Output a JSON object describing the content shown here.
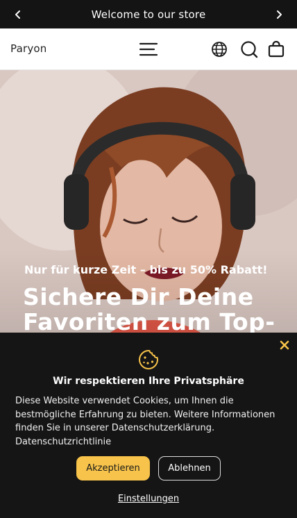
{
  "announcement": {
    "text": "Welcome to our store",
    "prev_icon": "chevron-left-icon",
    "next_icon": "chevron-right-icon"
  },
  "header": {
    "logo": "Paryon",
    "menu_icon": "hamburger-menu-icon",
    "icons": [
      "globe-icon",
      "search-icon",
      "shopping-bag-icon"
    ]
  },
  "hero": {
    "kicker": "Nur für kurze Zeit – bis zu 50% Rabatt!",
    "title": "Sichere Dir Deine Favoriten zum Top-"
  },
  "cookie_banner": {
    "title": "Wir respektieren Ihre Privatsphäre",
    "body": "Diese Website verwendet Cookies, um Ihnen die bestmögliche Erfahrung zu bieten. Weitere Informationen finden Sie in unserer Datenschutzerklärung.",
    "privacy_link": "Datenschutzrichtlinie",
    "accept_label": "Akzeptieren",
    "decline_label": "Ablehnen",
    "settings_label": "Einstellungen",
    "accent_color": "#F7C34A",
    "close_color": "#F7C34A"
  }
}
